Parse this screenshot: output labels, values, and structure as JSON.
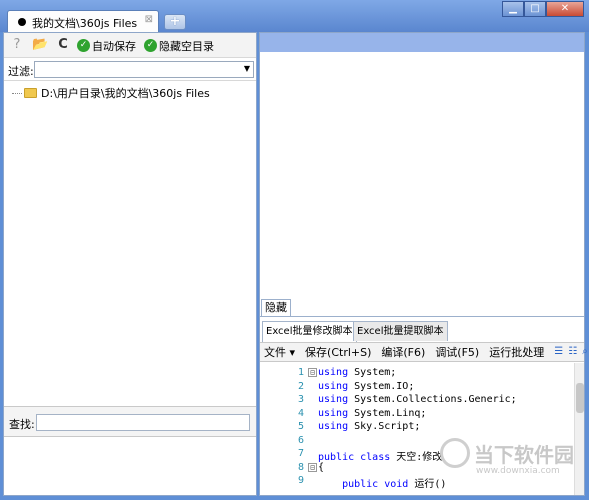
{
  "window": {
    "tab_title": "我的文档\\360js Files",
    "tab_close": "⊠",
    "new_tab": "+",
    "minimize": "▁",
    "maximize": "□",
    "close": "✕"
  },
  "left_toolbar": {
    "help_icon": "?",
    "open_icon": "📂",
    "refresh_icon": "C",
    "auto_save_label": "自动保存",
    "hide_empty_label": "隐藏空目录",
    "check_mark": "✓"
  },
  "filter": {
    "label": "过滤:",
    "value": "",
    "arrow": "▼"
  },
  "tree": {
    "items": [
      {
        "label": "D:\\用户目录\\我的文档\\360js Files"
      }
    ]
  },
  "search": {
    "label": "查找:",
    "value": ""
  },
  "right": {
    "hide_tab": "隐藏",
    "script_tabs": [
      {
        "label": "Excel批量修改脚本",
        "active": true
      },
      {
        "label": "Excel批量提取脚本",
        "active": false
      }
    ],
    "editor_toolbar": {
      "file": "文件 ▾",
      "save": "保存(Ctrl+S)",
      "compile": "编译(F6)",
      "debug": "调试(F5)",
      "batch": "运行批处理"
    },
    "code_lines": [
      {
        "n": "1",
        "fold": "⊟",
        "kw": "using",
        "rest": " System;"
      },
      {
        "n": "2",
        "fold": "",
        "kw": "using",
        "rest": " System.IO;"
      },
      {
        "n": "3",
        "fold": "",
        "kw": "using",
        "rest": " System.Collections.Generic;"
      },
      {
        "n": "4",
        "fold": "",
        "kw": "using",
        "rest": " System.Linq;"
      },
      {
        "n": "5",
        "fold": "",
        "kw": "using",
        "rest": " Sky.Script;"
      },
      {
        "n": "6",
        "fold": "",
        "kw": "",
        "rest": ""
      },
      {
        "n": "7",
        "fold": "",
        "kw": "public class",
        "rest": " 天空:修改"
      },
      {
        "n": "8",
        "fold": "⊟",
        "kw": "",
        "rest": "{"
      },
      {
        "n": "9",
        "fold": "",
        "kw": "    public void",
        "rest": " 运行()"
      }
    ]
  },
  "watermark": {
    "text": "当下软件园",
    "domain": "www.downxia.com"
  }
}
